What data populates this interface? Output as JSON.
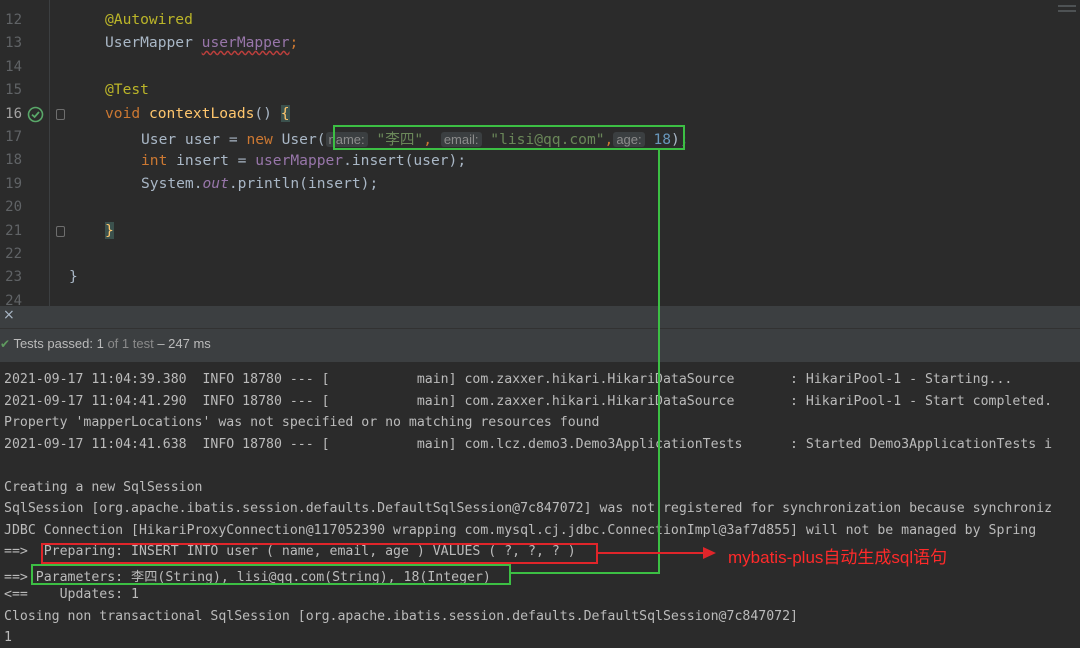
{
  "editor": {
    "line_numbers": [
      "12",
      "13",
      "14",
      "15",
      "16",
      "17",
      "18",
      "19",
      "20",
      "21",
      "22",
      "23",
      "24"
    ],
    "lines": {
      "l12": {
        "annotation": "@Autowired"
      },
      "l13": {
        "type": "UserMapper",
        "field": "userMapper",
        "semi": ";"
      },
      "l15": {
        "annotation": "@Test"
      },
      "l16": {
        "kw": "void",
        "method": "contextLoads",
        "rest": "() ",
        "brace": "{"
      },
      "l17": {
        "decl": "User user = ",
        "kw_new": "new",
        "ctor": " User(",
        "hint_name": "name:",
        "val_name": "\"李四\"",
        "comma1": ",",
        "hint_email": "email:",
        "val_email": "\"lisi@qq.com\"",
        "comma2": ",",
        "hint_age": "age:",
        "val_age": "18",
        "end": ");"
      },
      "l18": {
        "kw_int": "int",
        "decl": " insert = ",
        "field": "userMapper",
        "call": ".insert(user);"
      },
      "l19": {
        "prefix": "System.",
        "field": "out",
        "call": ".println(insert);"
      },
      "l21": {
        "brace": "}"
      },
      "l23": {
        "brace": "}"
      }
    }
  },
  "test_panel": {
    "close_icon": "×",
    "status_label": "Tests passed:",
    "status_count": "1",
    "status_of": "of 1 test",
    "status_time": "– 247 ms"
  },
  "console": {
    "lines": [
      "2021-09-17 11:04:39.380  INFO 18780 --- [           main] com.zaxxer.hikari.HikariDataSource       : HikariPool-1 - Starting...",
      "2021-09-17 11:04:41.290  INFO 18780 --- [           main] com.zaxxer.hikari.HikariDataSource       : HikariPool-1 - Start completed.",
      "Property 'mapperLocations' was not specified or no matching resources found",
      "2021-09-17 11:04:41.638  INFO 18780 --- [           main] com.lcz.demo3.Demo3ApplicationTests      : Started Demo3ApplicationTests i",
      "",
      "Creating a new SqlSession",
      "SqlSession [org.apache.ibatis.session.defaults.DefaultSqlSession@7c847072] was not registered for synchronization because synchroniz",
      "JDBC Connection [HikariProxyConnection@117052390 wrapping com.mysql.cj.jdbc.ConnectionImpl@3af7d855] will not be managed by Spring",
      "==>  Preparing: INSERT INTO user ( name, email, age ) VALUES ( ?, ?, ? )",
      "==> Parameters: 李四(String), lisi@qq.com(String), 18(Integer)",
      "<==    Updates: 1",
      "Closing non transactional SqlSession [org.apache.ibatis.session.defaults.DefaultSqlSession@7c847072]",
      "1"
    ]
  },
  "annotation": {
    "text": "mybatis-plus自动生成sql语句",
    "color": "#ff2a2a"
  },
  "colors": {
    "highlight_box": "#3cbf44",
    "annotation_box": "#e0252a",
    "test_passed": "#5f9b5f"
  }
}
